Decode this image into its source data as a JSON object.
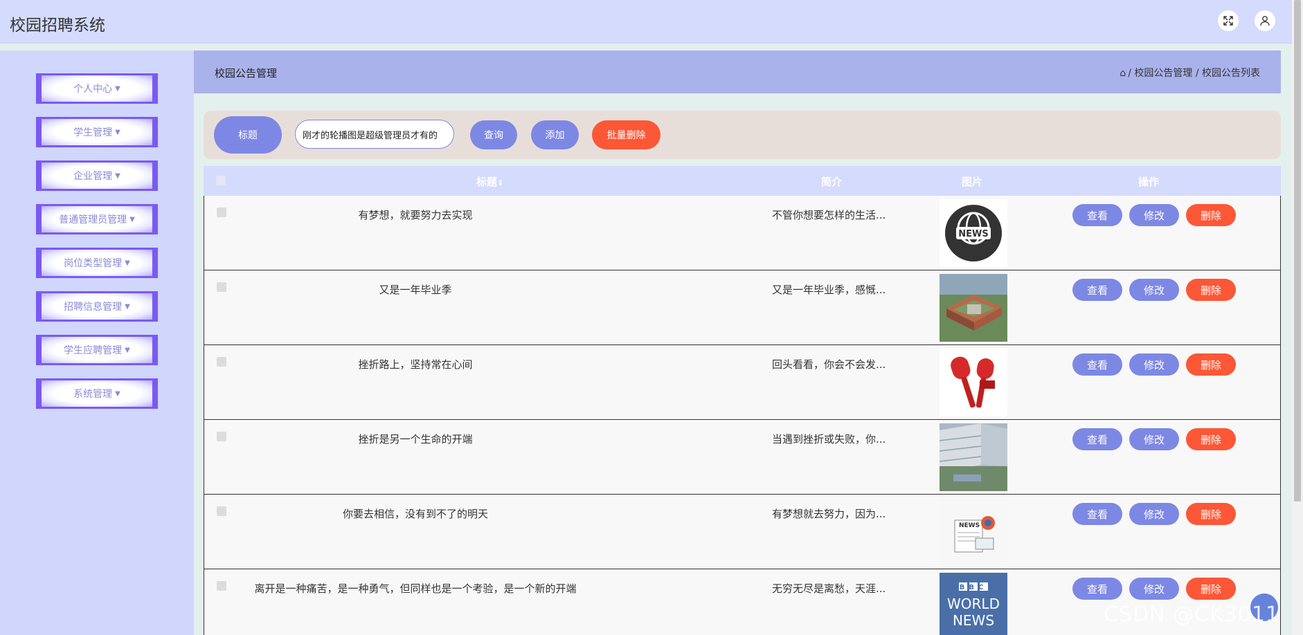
{
  "app": {
    "title": "校园招聘系统"
  },
  "topbar": {
    "fullscreen_icon": "expand-icon",
    "user_icon": "user-icon"
  },
  "sidebar": {
    "items": [
      {
        "label": "个人中心"
      },
      {
        "label": "学生管理"
      },
      {
        "label": "企业管理"
      },
      {
        "label": "普通管理员管理"
      },
      {
        "label": "岗位类型管理"
      },
      {
        "label": "招聘信息管理"
      },
      {
        "label": "学生应聘管理"
      },
      {
        "label": "系统管理"
      }
    ]
  },
  "breadcrumb": {
    "title": "校园公告管理",
    "path": "/ 校园公告管理 / 校园公告列表"
  },
  "search": {
    "label": "标题",
    "value": "刚才的轮播图是超级管理员才有的",
    "query_label": "查询",
    "add_label": "添加",
    "batch_delete_label": "批量删除"
  },
  "table": {
    "headers": {
      "title": "标题",
      "title_sort": "⇕",
      "intro": "简介",
      "image": "图片",
      "actions": "操作"
    },
    "rows": [
      {
        "title": "有梦想，就要努力去实现",
        "intro": "不管你想要怎样的生活...",
        "image": "news-globe-icon"
      },
      {
        "title": "又是一年毕业季",
        "intro": "又是一年毕业季，感慨...",
        "image": "campus-building-photo"
      },
      {
        "title": "挫折路上，坚持常在心间",
        "intro": "回头看看，你会不会发...",
        "image": "live-microphone-icon"
      },
      {
        "title": "挫折是另一个生命的开端",
        "intro": "当遇到挫折或失败，你...",
        "image": "campus-courtyard-photo"
      },
      {
        "title": "你要去相信，没有到不了的明天",
        "intro": "有梦想就去努力，因为...",
        "image": "newspaper-illustration"
      },
      {
        "title": "离开是一种痛苦，是一种勇气，但同样也是一个考验，是一个新的开端",
        "intro": "无穷无尽是离愁，天涯...",
        "image": "bbc-world-news-logo"
      }
    ],
    "view_label": "查看",
    "edit_label": "修改",
    "delete_label": "删除"
  },
  "bbc_logo": {
    "line1": "BBC",
    "line2": "WORLD",
    "line3": "NEWS"
  },
  "news_badge": "NEWS",
  "watermark": "CSDN @CK3011",
  "colors": {
    "accent": "#7d88e4",
    "danger": "#fc5736",
    "menu": "#7a5af2",
    "header": "#d5dbfd"
  }
}
